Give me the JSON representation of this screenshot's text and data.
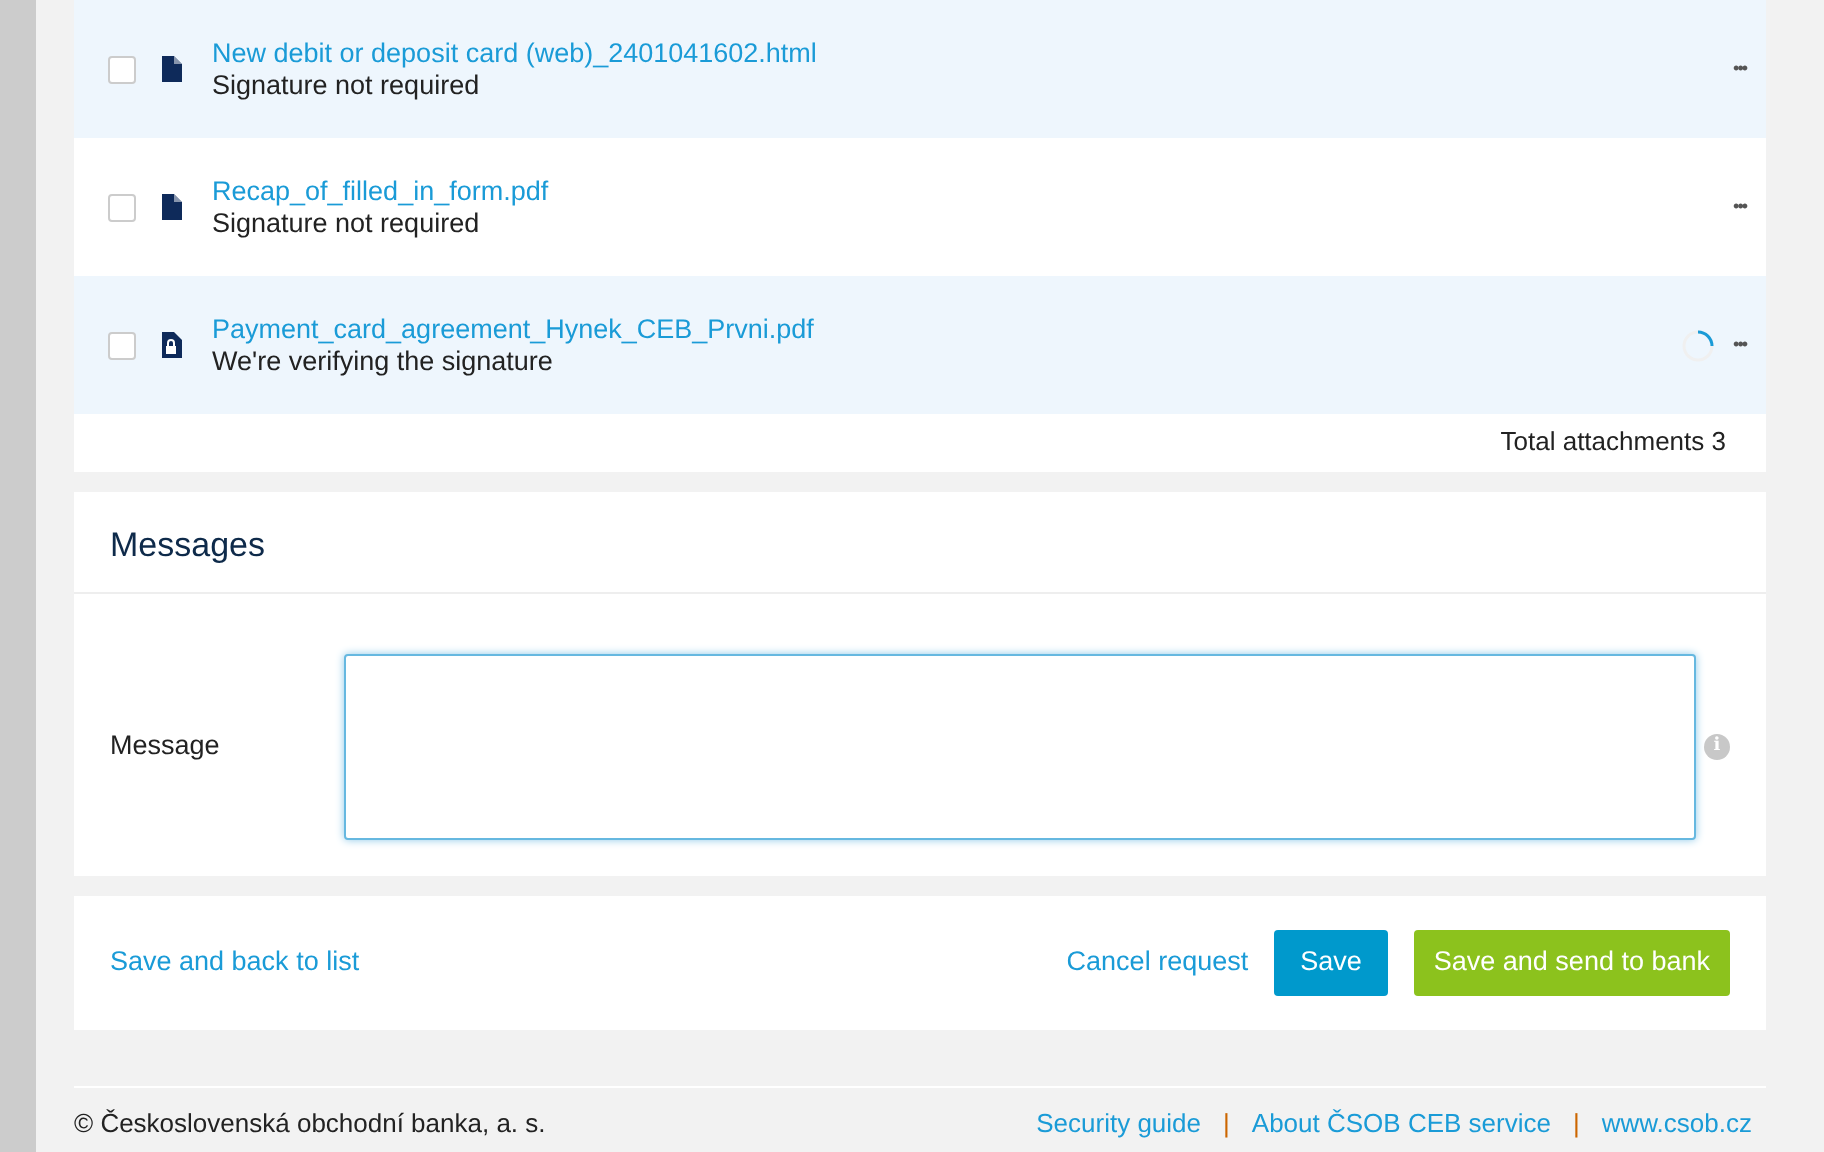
{
  "attachments": [
    {
      "name": "New debit or deposit card (web)_2401041602.html",
      "status": "Signature not required",
      "kind": "document",
      "checked": false,
      "verifying": false,
      "menu": "•••"
    },
    {
      "name": "Recap_of_filled_in_form.pdf",
      "status": "Signature not required",
      "kind": "document",
      "checked": false,
      "verifying": false,
      "menu": "•••"
    },
    {
      "name": "Payment_card_agreement_Hynek_CEB_Prvni.pdf",
      "status": "We're verifying the signature",
      "kind": "locked-document",
      "checked": false,
      "verifying": true,
      "menu": "•••"
    }
  ],
  "total": {
    "label": "Total attachments",
    "count": "3"
  },
  "messages": {
    "title": "Messages",
    "field_label": "Message",
    "info": "i"
  },
  "actions": {
    "back": "Save and back to list",
    "cancel": "Cancel request",
    "save": "Save",
    "send": "Save and send to bank"
  },
  "footer": {
    "copyright": "© Československá obchodní banka, a. s.",
    "items": [
      {
        "kind": "link",
        "text": "Security guide"
      },
      {
        "kind": "separator",
        "text": "|"
      },
      {
        "kind": "link",
        "text": "About ČSOB CEB service"
      },
      {
        "kind": "separator",
        "text": "|"
      },
      {
        "kind": "link",
        "text": "www.csob.cz"
      }
    ]
  }
}
